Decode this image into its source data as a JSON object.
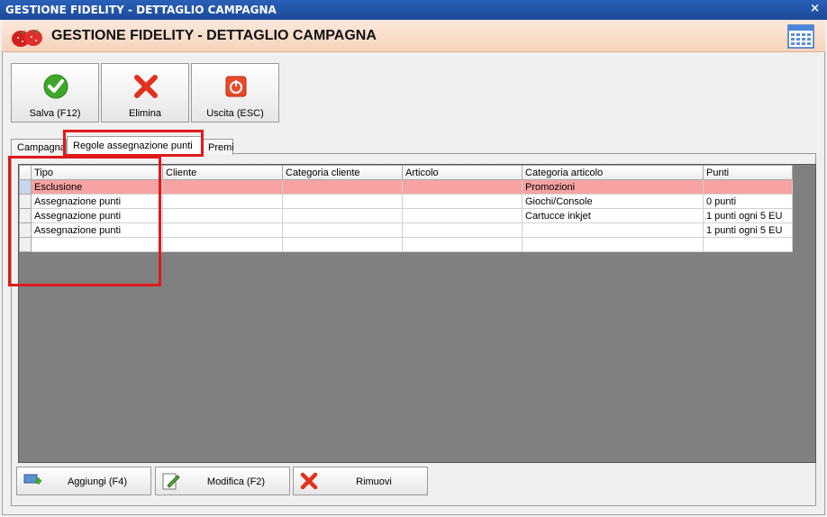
{
  "window": {
    "title": "GESTIONE FIDELITY - DETTAGLIO CAMPAGNA",
    "close_glyph": "×"
  },
  "header": {
    "title": "GESTIONE FIDELITY - DETTAGLIO CAMPAGNA"
  },
  "toolbar": {
    "save_label": "Salva (F12)",
    "delete_label": "Elimina",
    "exit_label": "Uscita (ESC)"
  },
  "tabs": [
    {
      "label": "Campagna"
    },
    {
      "label": "Regole assegnazione punti"
    },
    {
      "label": "Premi"
    }
  ],
  "grid": {
    "columns": [
      "Tipo",
      "Cliente",
      "Categoria cliente",
      "Articolo",
      "Categoria articolo",
      "Punti"
    ],
    "rows": [
      {
        "tipo": "Esclusione",
        "cliente": "",
        "categoria_cliente": "",
        "articolo": "",
        "categoria_articolo": "Promozioni",
        "punti": ""
      },
      {
        "tipo": "Assegnazione punti",
        "cliente": "",
        "categoria_cliente": "",
        "articolo": "",
        "categoria_articolo": "Giochi/Console",
        "punti": "0 punti"
      },
      {
        "tipo": "Assegnazione punti",
        "cliente": "",
        "categoria_cliente": "",
        "articolo": "",
        "categoria_articolo": "Cartucce inkjet",
        "punti": "1 punti ogni 5 EU"
      },
      {
        "tipo": "Assegnazione punti",
        "cliente": "",
        "categoria_cliente": "",
        "articolo": "",
        "categoria_articolo": "",
        "punti": "1 punti ogni 5 EU"
      },
      {
        "tipo": "",
        "cliente": "",
        "categoria_cliente": "",
        "articolo": "",
        "categoria_articolo": "",
        "punti": ""
      }
    ]
  },
  "bottom": {
    "add_label": "Aggiungi (F4)",
    "edit_label": "Modifica (F2)",
    "remove_label": "Rimuovi"
  },
  "colors": {
    "selected_row": "#f7a3a3",
    "highlight_box": "#e0191b",
    "title_bar": "#1c4a98"
  }
}
